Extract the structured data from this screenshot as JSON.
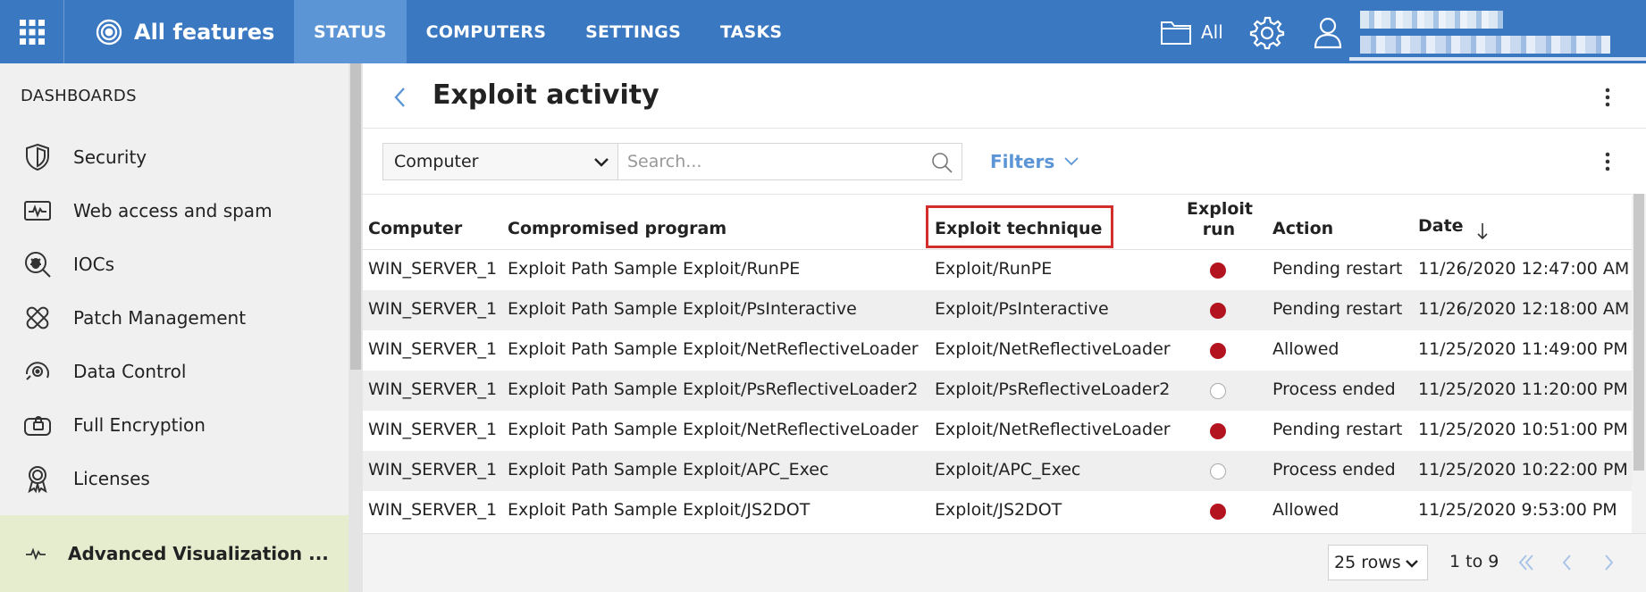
{
  "topbar": {
    "brand": "All features",
    "tabs": [
      {
        "label": "STATUS",
        "active": true
      },
      {
        "label": "COMPUTERS",
        "active": false
      },
      {
        "label": "SETTINGS",
        "active": false
      },
      {
        "label": "TASKS",
        "active": false
      }
    ],
    "folder_label": "All",
    "icons": [
      "apps-grid-icon",
      "target-logo-icon",
      "folder-icon",
      "gear-icon",
      "user-icon"
    ],
    "color": "#3a78c2",
    "active_tab_color": "#5b95d6"
  },
  "sidebar": {
    "title": "DASHBOARDS",
    "items": [
      {
        "label": "Security",
        "icon": "shield-icon"
      },
      {
        "label": "Web access and spam",
        "icon": "pulse-monitor-icon"
      },
      {
        "label": "IOCs",
        "icon": "magnifier-bug-icon"
      },
      {
        "label": "Patch Management",
        "icon": "bandage-icon"
      },
      {
        "label": "Data Control",
        "icon": "data-eye-icon"
      },
      {
        "label": "Full Encryption",
        "icon": "encrypted-drive-icon"
      },
      {
        "label": "Licenses",
        "icon": "award-badge-icon"
      }
    ],
    "advanced": {
      "label": "Advanced Visualization ...",
      "icon": "pulse-line-icon",
      "color": "#e6edcf"
    }
  },
  "main": {
    "title": "Exploit activity",
    "toolbar": {
      "column_select": "Computer",
      "search_placeholder": "Search...",
      "filters_label": "Filters"
    },
    "table": {
      "headers": {
        "computer": "Computer",
        "program": "Compromised program",
        "technique": "Exploit technique",
        "exploit_run_1": "Exploit",
        "exploit_run_2": "run",
        "action": "Action",
        "date": "Date"
      },
      "sorted_by": "date",
      "sort_direction": "descending",
      "highlighted_column": "technique",
      "highlight_color": "#d22e2e",
      "rows": [
        {
          "computer": "WIN_SERVER_1",
          "program": "Exploit Path Sample Exploit/RunPE",
          "technique": "Exploit/RunPE",
          "exploit_run": true,
          "action": "Pending restart",
          "date": "11/26/2020 12:47:00 AM"
        },
        {
          "computer": "WIN_SERVER_1",
          "program": "Exploit Path Sample Exploit/PsInteractive",
          "technique": "Exploit/PsInteractive",
          "exploit_run": true,
          "action": "Pending restart",
          "date": "11/26/2020 12:18:00 AM"
        },
        {
          "computer": "WIN_SERVER_1",
          "program": "Exploit Path Sample Exploit/NetReflectiveLoader",
          "technique": "Exploit/NetReflectiveLoader",
          "exploit_run": true,
          "action": "Allowed",
          "date": "11/25/2020 11:49:00 PM"
        },
        {
          "computer": "WIN_SERVER_1",
          "program": "Exploit Path Sample Exploit/PsReflectiveLoader2",
          "technique": "Exploit/PsReflectiveLoader2",
          "exploit_run": false,
          "action": "Process ended",
          "date": "11/25/2020 11:20:00 PM"
        },
        {
          "computer": "WIN_SERVER_1",
          "program": "Exploit Path Sample Exploit/NetReflectiveLoader",
          "technique": "Exploit/NetReflectiveLoader",
          "exploit_run": true,
          "action": "Pending restart",
          "date": "11/25/2020 10:51:00 PM"
        },
        {
          "computer": "WIN_SERVER_1",
          "program": "Exploit Path Sample Exploit/APC_Exec",
          "technique": "Exploit/APC_Exec",
          "exploit_run": false,
          "action": "Process ended",
          "date": "11/25/2020 10:22:00 PM"
        },
        {
          "computer": "WIN_SERVER_1",
          "program": "Exploit Path Sample Exploit/JS2DOT",
          "technique": "Exploit/JS2DOT",
          "exploit_run": true,
          "action": "Allowed",
          "date": "11/25/2020 9:53:00 PM"
        }
      ],
      "run_color": "#b3131f"
    },
    "pagination": {
      "rows_per_page": "25 rows",
      "range": "1 to 9"
    }
  }
}
